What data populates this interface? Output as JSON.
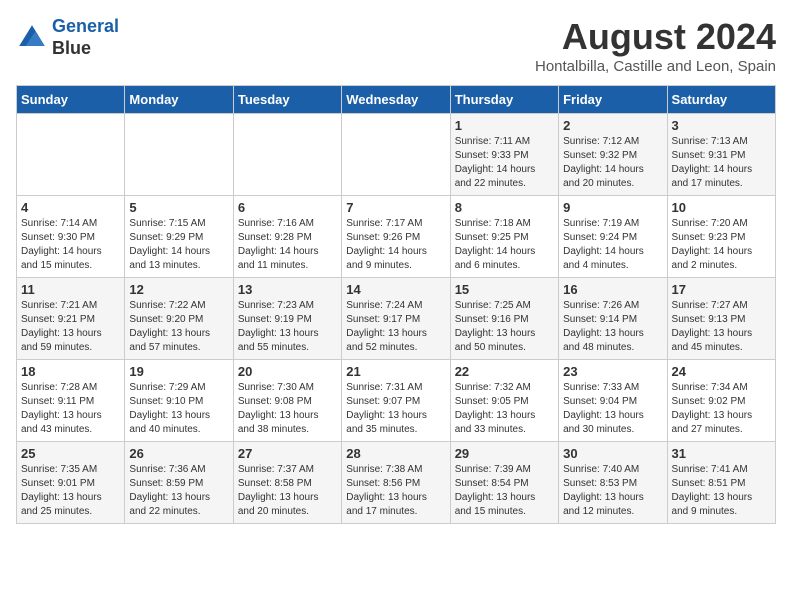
{
  "header": {
    "logo_line1": "General",
    "logo_line2": "Blue",
    "month_title": "August 2024",
    "subtitle": "Hontalbilla, Castille and Leon, Spain"
  },
  "days_of_week": [
    "Sunday",
    "Monday",
    "Tuesday",
    "Wednesday",
    "Thursday",
    "Friday",
    "Saturday"
  ],
  "weeks": [
    [
      {
        "day": "",
        "info": ""
      },
      {
        "day": "",
        "info": ""
      },
      {
        "day": "",
        "info": ""
      },
      {
        "day": "",
        "info": ""
      },
      {
        "day": "1",
        "info": "Sunrise: 7:11 AM\nSunset: 9:33 PM\nDaylight: 14 hours\nand 22 minutes."
      },
      {
        "day": "2",
        "info": "Sunrise: 7:12 AM\nSunset: 9:32 PM\nDaylight: 14 hours\nand 20 minutes."
      },
      {
        "day": "3",
        "info": "Sunrise: 7:13 AM\nSunset: 9:31 PM\nDaylight: 14 hours\nand 17 minutes."
      }
    ],
    [
      {
        "day": "4",
        "info": "Sunrise: 7:14 AM\nSunset: 9:30 PM\nDaylight: 14 hours\nand 15 minutes."
      },
      {
        "day": "5",
        "info": "Sunrise: 7:15 AM\nSunset: 9:29 PM\nDaylight: 14 hours\nand 13 minutes."
      },
      {
        "day": "6",
        "info": "Sunrise: 7:16 AM\nSunset: 9:28 PM\nDaylight: 14 hours\nand 11 minutes."
      },
      {
        "day": "7",
        "info": "Sunrise: 7:17 AM\nSunset: 9:26 PM\nDaylight: 14 hours\nand 9 minutes."
      },
      {
        "day": "8",
        "info": "Sunrise: 7:18 AM\nSunset: 9:25 PM\nDaylight: 14 hours\nand 6 minutes."
      },
      {
        "day": "9",
        "info": "Sunrise: 7:19 AM\nSunset: 9:24 PM\nDaylight: 14 hours\nand 4 minutes."
      },
      {
        "day": "10",
        "info": "Sunrise: 7:20 AM\nSunset: 9:23 PM\nDaylight: 14 hours\nand 2 minutes."
      }
    ],
    [
      {
        "day": "11",
        "info": "Sunrise: 7:21 AM\nSunset: 9:21 PM\nDaylight: 13 hours\nand 59 minutes."
      },
      {
        "day": "12",
        "info": "Sunrise: 7:22 AM\nSunset: 9:20 PM\nDaylight: 13 hours\nand 57 minutes."
      },
      {
        "day": "13",
        "info": "Sunrise: 7:23 AM\nSunset: 9:19 PM\nDaylight: 13 hours\nand 55 minutes."
      },
      {
        "day": "14",
        "info": "Sunrise: 7:24 AM\nSunset: 9:17 PM\nDaylight: 13 hours\nand 52 minutes."
      },
      {
        "day": "15",
        "info": "Sunrise: 7:25 AM\nSunset: 9:16 PM\nDaylight: 13 hours\nand 50 minutes."
      },
      {
        "day": "16",
        "info": "Sunrise: 7:26 AM\nSunset: 9:14 PM\nDaylight: 13 hours\nand 48 minutes."
      },
      {
        "day": "17",
        "info": "Sunrise: 7:27 AM\nSunset: 9:13 PM\nDaylight: 13 hours\nand 45 minutes."
      }
    ],
    [
      {
        "day": "18",
        "info": "Sunrise: 7:28 AM\nSunset: 9:11 PM\nDaylight: 13 hours\nand 43 minutes."
      },
      {
        "day": "19",
        "info": "Sunrise: 7:29 AM\nSunset: 9:10 PM\nDaylight: 13 hours\nand 40 minutes."
      },
      {
        "day": "20",
        "info": "Sunrise: 7:30 AM\nSunset: 9:08 PM\nDaylight: 13 hours\nand 38 minutes."
      },
      {
        "day": "21",
        "info": "Sunrise: 7:31 AM\nSunset: 9:07 PM\nDaylight: 13 hours\nand 35 minutes."
      },
      {
        "day": "22",
        "info": "Sunrise: 7:32 AM\nSunset: 9:05 PM\nDaylight: 13 hours\nand 33 minutes."
      },
      {
        "day": "23",
        "info": "Sunrise: 7:33 AM\nSunset: 9:04 PM\nDaylight: 13 hours\nand 30 minutes."
      },
      {
        "day": "24",
        "info": "Sunrise: 7:34 AM\nSunset: 9:02 PM\nDaylight: 13 hours\nand 27 minutes."
      }
    ],
    [
      {
        "day": "25",
        "info": "Sunrise: 7:35 AM\nSunset: 9:01 PM\nDaylight: 13 hours\nand 25 minutes."
      },
      {
        "day": "26",
        "info": "Sunrise: 7:36 AM\nSunset: 8:59 PM\nDaylight: 13 hours\nand 22 minutes."
      },
      {
        "day": "27",
        "info": "Sunrise: 7:37 AM\nSunset: 8:58 PM\nDaylight: 13 hours\nand 20 minutes."
      },
      {
        "day": "28",
        "info": "Sunrise: 7:38 AM\nSunset: 8:56 PM\nDaylight: 13 hours\nand 17 minutes."
      },
      {
        "day": "29",
        "info": "Sunrise: 7:39 AM\nSunset: 8:54 PM\nDaylight: 13 hours\nand 15 minutes."
      },
      {
        "day": "30",
        "info": "Sunrise: 7:40 AM\nSunset: 8:53 PM\nDaylight: 13 hours\nand 12 minutes."
      },
      {
        "day": "31",
        "info": "Sunrise: 7:41 AM\nSunset: 8:51 PM\nDaylight: 13 hours\nand 9 minutes."
      }
    ]
  ]
}
